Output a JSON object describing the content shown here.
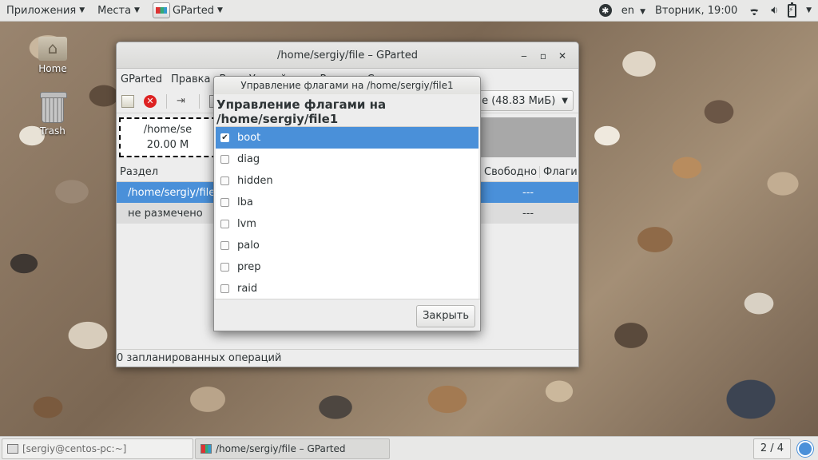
{
  "topbar": {
    "applications": "Приложения",
    "places": "Места",
    "app_name": "GParted",
    "lang": "en",
    "clock": "Вторник, 19:00"
  },
  "desktop": {
    "home_label": "Home",
    "trash_label": "Trash"
  },
  "gparted": {
    "title": "/home/sergiy/file – GParted",
    "menu": [
      "GParted",
      "Правка",
      "Вид",
      "Устройство",
      "Раздел",
      "Справка"
    ],
    "device_selector": "le (48.83 МиБ)",
    "disk_part_name": "/home/se",
    "disk_part_size": "20.00 M",
    "columns": {
      "partition": "Раздел",
      "free": "Свободно",
      "flags": "Флаги"
    },
    "rows": [
      {
        "name": "/home/sergiy/file1",
        "flags": "---"
      },
      {
        "name": "не размечено",
        "flags": "---"
      }
    ],
    "status": "0 запланированных операций"
  },
  "dialog": {
    "title": "Управление флагами на /home/sergiy/file1",
    "heading": "Управление флагами на /home/sergiy/file1",
    "flags": [
      {
        "name": "boot",
        "checked": true
      },
      {
        "name": "diag",
        "checked": false
      },
      {
        "name": "hidden",
        "checked": false
      },
      {
        "name": "lba",
        "checked": false
      },
      {
        "name": "lvm",
        "checked": false
      },
      {
        "name": "palo",
        "checked": false
      },
      {
        "name": "prep",
        "checked": false
      },
      {
        "name": "raid",
        "checked": false
      }
    ],
    "close_label": "Закрыть"
  },
  "taskbar": {
    "terminal": "[sergiy@centos-pc:~]",
    "gparted": "/home/sergiy/file – GParted",
    "workspace": "2 / 4"
  },
  "colors": {
    "selection": "#4a90d9",
    "panel": "#e8e8e7"
  }
}
